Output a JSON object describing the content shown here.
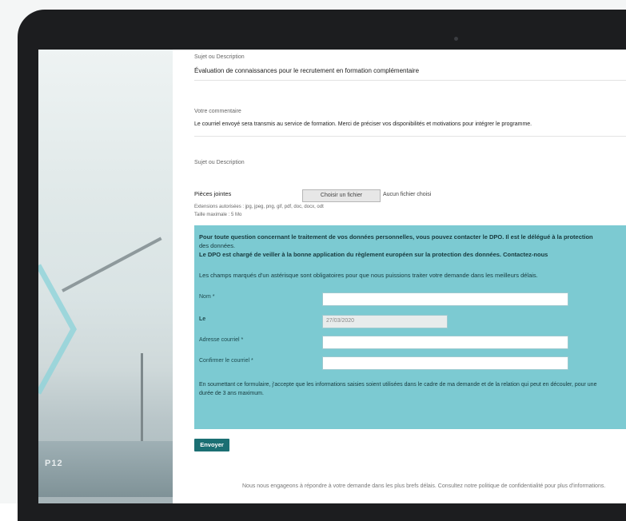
{
  "form": {
    "field1_label": "Sujet ou Description",
    "field1_value": "Évaluation de connaissances pour le recrutement en formation complémentaire",
    "field2_label": "Votre commentaire",
    "field2_value": "Le courriel envoyé sera transmis au service de formation. Merci de préciser vos disponibilités et motivations pour intégrer le programme.",
    "field3_label": "Sujet ou Description",
    "attach_label": "Pièces jointes",
    "file_button": "Choisir un fichier",
    "file_status": "Aucun fichier choisi",
    "attach_hint1": "Extensions autorisées : jpg, jpeg, png, gif, pdf, doc, docx, odt",
    "attach_hint2": "Taille maximale : 5 Mo",
    "info_line1": "Pour toute question concernant le traitement de vos données personnelles, vous pouvez contacter le DPO. Il est le délégué à la protection",
    "info_line2": "des données.",
    "info_line3": "Le DPO est chargé de veiller à la bonne application du règlement européen sur la protection des données. Contactez-nous",
    "info_line4": "Les champs marqués d'un astérisque sont obligatoires pour que nous puissions traiter votre demande dans les meilleurs délais.",
    "label_nom": "Nom *",
    "label_le": "Le",
    "date_value": "27/03/2020",
    "label_courriel": "Adresse courriel *",
    "label_confirm": "Confirmer le courriel *",
    "consent_line1": "En soumettant ce formulaire, j'accepte que les informations saisies soient utilisées dans le cadre de ma demande et de la relation qui peut en découler, pour une",
    "consent_line2": "durée de 3 ans maximum.",
    "send_button": "Envoyer",
    "footer": "Nous nous engageons à répondre à votre demande dans les plus brefs délais. Consultez notre politique de confidentialité pour plus d'informations."
  },
  "photo": {
    "ship_number": "P12"
  },
  "colors": {
    "accent": "#7ccad2",
    "button": "#1b6f73",
    "bezel": "#1c1d1f"
  }
}
